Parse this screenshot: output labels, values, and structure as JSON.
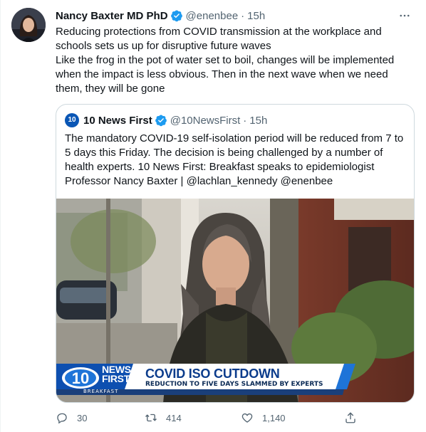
{
  "tweet": {
    "author_name": "Nancy Baxter MD PhD",
    "handle": "@enenbee",
    "separator": "·",
    "time": "15h",
    "line1": "Reducing protections from COVID transmission at the workplace and schools sets us up for disruptive future waves",
    "line2": "Like the frog in the pot of water set to boil, changes will be implemented when the impact is less obvious. Then in the next wave when we need them, they will be gone"
  },
  "quote": {
    "avatar_text": "10",
    "author_name": "10 News First",
    "handle": "@10NewsFirst",
    "separator": "·",
    "time": "15h",
    "text": "The mandatory COVID-19 self-isolation period will be reduced from 7 to 5 days this Friday. The decision is being challenged by a number of health experts. 10 News First: Breakfast speaks to epidemiologist Professor Nancy Baxter | @lachlan_kennedy @enenbee",
    "media": {
      "logo_number": "10",
      "brand_line1": "NEWS",
      "brand_line2": "FIRST",
      "brand_sub": "BREAKFAST",
      "headline": "COVID ISO CUTDOWN",
      "strap": "REDUCTION TO FIVE DAYS SLAMMED BY EXPERTS"
    }
  },
  "actions": {
    "replies": "30",
    "retweets": "414",
    "likes": "1,140"
  },
  "icons": {
    "verified": "verified-badge-icon",
    "more": "more-icon",
    "reply": "reply-icon",
    "retweet": "retweet-icon",
    "like": "heart-icon",
    "share": "share-icon"
  },
  "colors": {
    "verified": "#1d9bf0",
    "secondary_text": "#536471",
    "lower_third_blue": "#0b3c8c"
  }
}
